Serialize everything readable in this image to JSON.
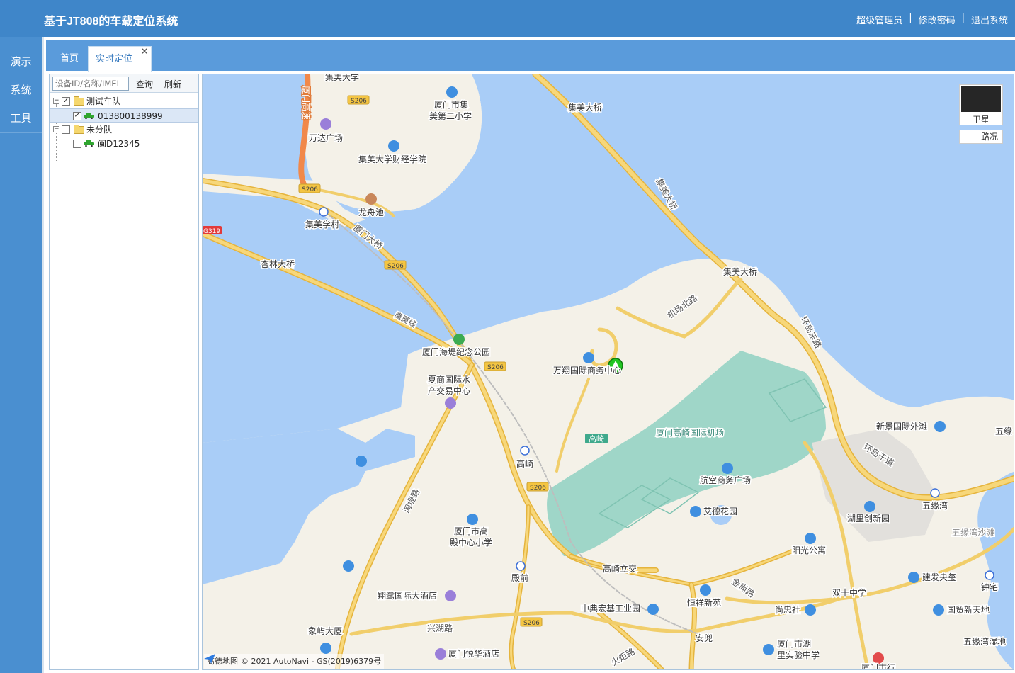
{
  "header": {
    "title": "基于JT808的车载定位系统",
    "links": [
      "超级管理员",
      "修改密码",
      "退出系统"
    ],
    "separator": "|"
  },
  "nav": {
    "items": [
      "演示",
      "系统",
      "工具"
    ]
  },
  "tabs": {
    "home": "首页",
    "realtime": "实时定位",
    "close": "×"
  },
  "tree": {
    "search_placeholder": "设备ID/名称/IMEI",
    "query_label": "查询",
    "refresh_label": "刷新",
    "nodes": [
      {
        "label": "测试车队",
        "checked": true,
        "expanded": true
      },
      {
        "label": "013800138999",
        "checked": true,
        "selected": true
      },
      {
        "label": "未分队",
        "checked": false,
        "expanded": true
      },
      {
        "label": "闽D12345",
        "checked": false
      }
    ],
    "expander": "−",
    "check": "✓"
  },
  "map": {
    "satellite_label": "卫星",
    "traffic_label": "路况",
    "copyright": "© 2021 AutoNavi - GS(2019)6379号",
    "logo_text": "高德地图",
    "labels": {
      "jimei_univ": "集美大学",
      "xiamen_expressway": "厦门高速",
      "school1_a": "厦门市集",
      "school1_b": "美第二小学",
      "wanda": "万达广场",
      "jimei_finance": "集美大学财经学院",
      "longzhou": "龙舟池",
      "jimei_xuecun": "集美学村",
      "xiamen_bridge": "厦门大桥",
      "xinglin_bridge": "杏林大桥",
      "yingxia_line": "鹰厦线",
      "jimei_bridge_top": "集美大桥",
      "jimei_bridge_v": "集美大桥",
      "jimei_bridge_mid": "集美大桥",
      "airport_north": "机场北路",
      "huandao_east": "环岛东路",
      "seawall_park": "厦门海堤纪念公园",
      "wanxiang": "万翔国际商务中心",
      "xiashang_a": "夏商国际水",
      "xiashang_b": "产交易中心",
      "gaoqi_station": "高崎",
      "gaoqi_badge": "高崎",
      "airport": "厦门高崎国际机场",
      "aviation_plaza": "航空商务广场",
      "aide": "艾德花园",
      "xinjing": "新景国际外滩",
      "huandao_trunk": "环岛干道",
      "wuyuan_bay": "五缘湾",
      "wuyuan_beach": "五缘湾沙滩",
      "wuyuan_top": "五缘",
      "huli_park": "湖里创新园",
      "yangguang": "阳光公寓",
      "jianfa": "建发央玺",
      "zhongzhai": "钟宅",
      "guomao": "国贸新天地",
      "wuyuan_wetland": "五缘湾湿地",
      "shuangshi": "双十中学",
      "shangzhong": "尚忠社",
      "hengxiang": "恒祥新苑",
      "jinshang_rd": "金尚路",
      "zhongdian": "中典宏基工业园",
      "gaoqi_interchange": "高崎立交",
      "dianqian": "殿前",
      "dianqian_school_a": "厦门市高",
      "dianqian_school_b": "殿中心小学",
      "xiangyu_hotel": "翔鹭国际大酒店",
      "xiangyu_bldg": "象屿大厦",
      "xinghu_rd": "兴湖路",
      "yuehua_hotel": "厦门悦华酒店",
      "huoju_rd": "火炬路",
      "anduo": "安兜",
      "huli_school_a": "厦门市湖",
      "huli_school_b": "里实验中学",
      "haibin_rd": "海堤路",
      "xiamen_city": "厦门市行",
      "road_s206": "S206",
      "road_g319": "G319"
    }
  },
  "colors": {
    "header_bg": "#3f86c9",
    "nav_bg": "#4a8fd0",
    "tab_bg": "#5a9bdb",
    "water": "#a9cdf7",
    "land": "#f4f1e8",
    "road_main": "#f2c14e",
    "airport": "#9fd6c8",
    "vehicle_marker": "#22c422"
  }
}
